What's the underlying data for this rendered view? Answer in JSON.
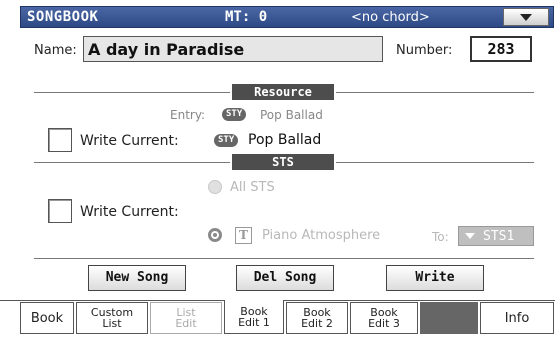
{
  "header": {
    "title": "SONGBOOK",
    "mt": "MT: 0",
    "chord": "<no chord>",
    "menu_icon": "chevron-down-icon"
  },
  "name_row": {
    "name_label": "Name:",
    "name_value": "A day in Paradise",
    "number_label": "Number:",
    "number_value": "283"
  },
  "resource": {
    "header": "Resource",
    "entry_label": "Entry:",
    "entry_badge": "STY",
    "entry_value": "Pop Ballad",
    "write_current_label": "Write Current:",
    "current_badge": "STY",
    "current_value": "Pop Ballad"
  },
  "sts": {
    "header": "STS",
    "write_current_label": "Write Current:",
    "option_all": "All STS",
    "option_single": "Piano Atmosphere",
    "to_label": "To:",
    "to_value": "STS1",
    "t_icon": "T"
  },
  "actions": {
    "new_song": "New Song",
    "del_song": "Del Song",
    "write": "Write"
  },
  "tabs": {
    "book": "Book",
    "custom_list_1": "Custom",
    "custom_list_2": "List",
    "list_edit_1": "List",
    "list_edit_2": "Edit",
    "book_edit1_1": "Book",
    "book_edit1_2": "Edit 1",
    "book_edit2_1": "Book",
    "book_edit2_2": "Edit 2",
    "book_edit3_1": "Book",
    "book_edit3_2": "Edit 3",
    "info": "Info"
  },
  "colors": {
    "titlebar": "#3a5796",
    "section_header": "#4d4d4d"
  }
}
